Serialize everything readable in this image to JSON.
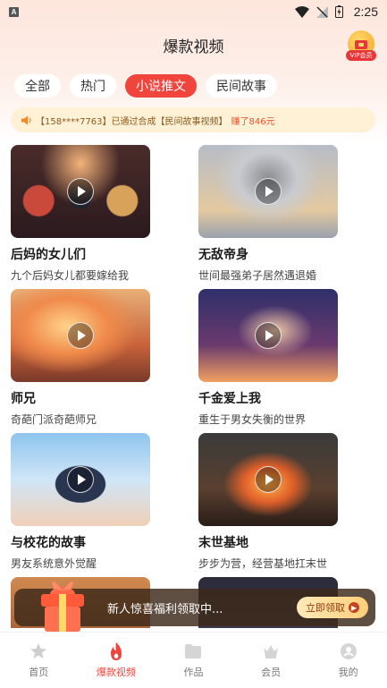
{
  "status_bar": {
    "time": "2:25",
    "notif_icon": "A"
  },
  "header": {
    "title": "爆款视频",
    "vip_label": "VIP会员"
  },
  "tabs": [
    {
      "label": "全部",
      "active": false
    },
    {
      "label": "热门",
      "active": false
    },
    {
      "label": "小说推文",
      "active": true
    },
    {
      "label": "民间故事",
      "active": false
    }
  ],
  "marquee": {
    "text": "【158****7763】已通过合成【民间故事视频】",
    "reward": "赚了846元"
  },
  "cards": [
    {
      "title": "后妈的女儿们",
      "desc": "九个后妈女儿都要嫁给我"
    },
    {
      "title": "无敌帝身",
      "desc": "世间最强弟子居然遇退婚"
    },
    {
      "title": "师兄",
      "desc": "奇葩门派奇葩师兄"
    },
    {
      "title": "千金爱上我",
      "desc": "重生于男女失衡的世界"
    },
    {
      "title": "与校花的故事",
      "desc": "男友系统意外觉醒"
    },
    {
      "title": "末世基地",
      "desc": "步步为营，经营基地扛末世"
    }
  ],
  "promo": {
    "text": "新人惊喜福利领取中...",
    "button": "立即领取"
  },
  "bottom_nav": [
    {
      "label": "首页",
      "icon": "home-star-icon",
      "active": false
    },
    {
      "label": "爆款视频",
      "icon": "flame-icon",
      "active": true
    },
    {
      "label": "作品",
      "icon": "folder-icon",
      "active": false
    },
    {
      "label": "会员",
      "icon": "crown-icon",
      "active": false
    },
    {
      "label": "我的",
      "icon": "profile-icon",
      "active": false
    }
  ],
  "colors": {
    "accent": "#f0443c",
    "reward": "#e8532f",
    "marquee_bg": "#fff1d6"
  }
}
